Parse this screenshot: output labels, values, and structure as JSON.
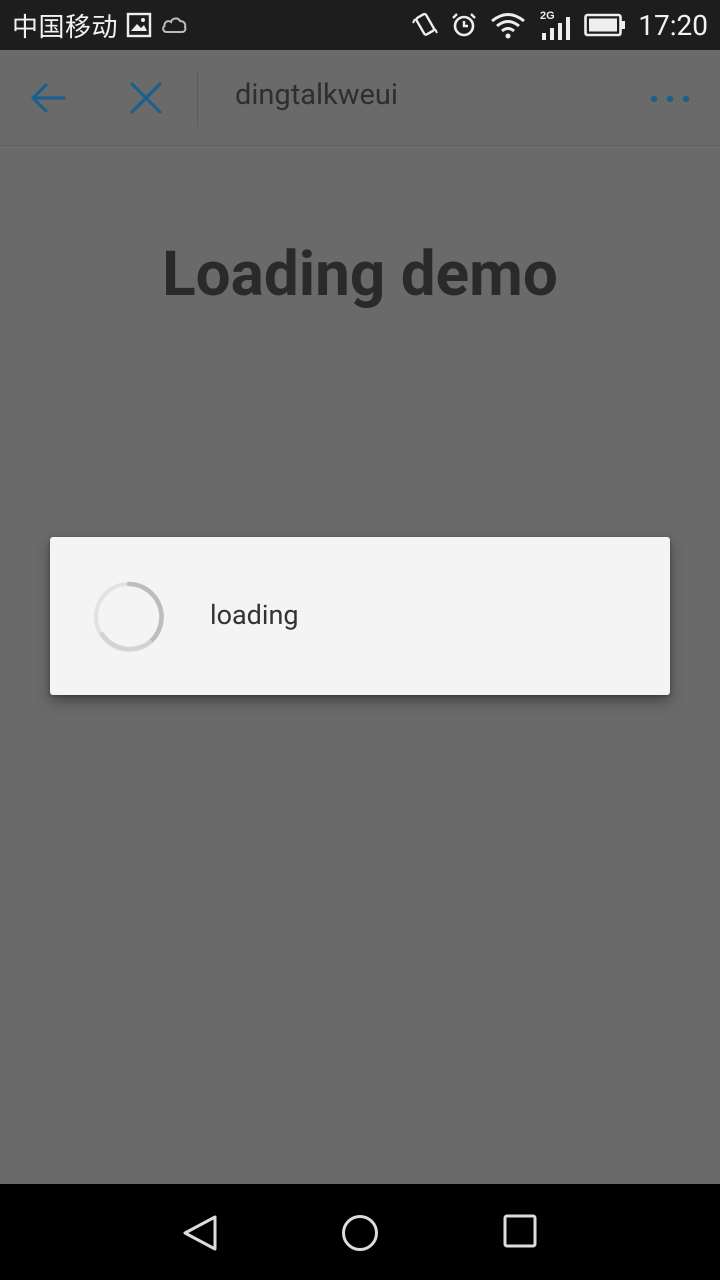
{
  "status_bar": {
    "carrier": "中国移动",
    "network": "2G",
    "time": "17:20"
  },
  "app_bar": {
    "title": "dingtalkweui",
    "accent_color": "#1b5f8c"
  },
  "page": {
    "heading": "Loading demo"
  },
  "loading_dialog": {
    "message": "loading"
  },
  "icons": [
    "image-icon",
    "cloud-icon",
    "vibrate-icon",
    "alarm-icon",
    "wifi-icon",
    "signal-icon",
    "battery-icon",
    "back-arrow-icon",
    "close-icon",
    "more-icon",
    "spinner-icon",
    "nav-back-icon",
    "nav-home-icon",
    "nav-recents-icon"
  ]
}
